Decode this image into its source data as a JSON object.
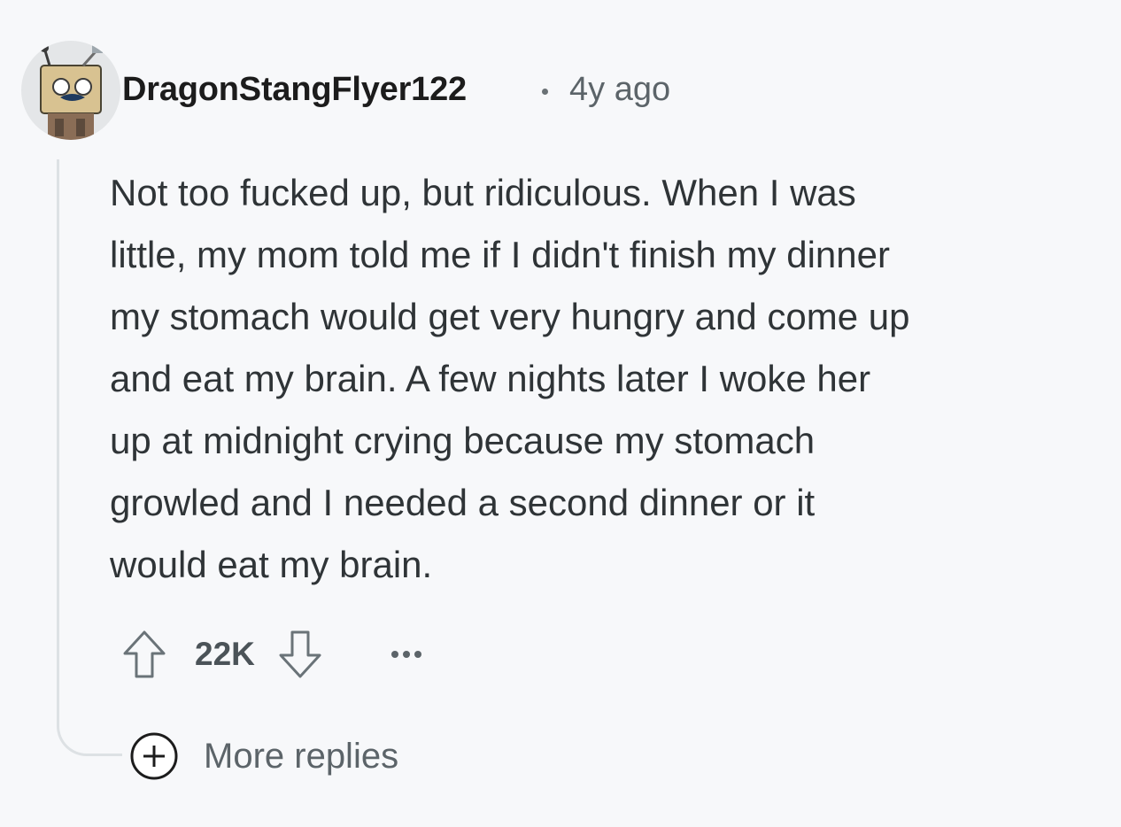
{
  "comment": {
    "username": "DragonStangFlyer122",
    "separator": "·",
    "time_ago": "4y ago",
    "body_lines": [
      "Not too fucked up, but ridiculous. When I was",
      "little, my mom told me if I didn't finish my dinner",
      "my stomach would get very hungry and come up",
      "and eat my brain. A few nights later I woke her",
      "up at midnight crying because my stomach",
      "growled and I needed a second dinner or it",
      "would eat my brain."
    ],
    "score": "22K",
    "icons": {
      "avatar": "robot-box-avatar",
      "upvote": "upvote-arrow-icon",
      "downvote": "downvote-arrow-icon",
      "more": "ellipsis-icon",
      "expand": "plus-circle-icon"
    },
    "more_replies_label": "More replies"
  },
  "colors": {
    "background": "#f7f8fa",
    "username": "#1c1c1c",
    "meta": "#5c6469",
    "body": "#2f3437",
    "thread_line": "#dde1e4"
  }
}
